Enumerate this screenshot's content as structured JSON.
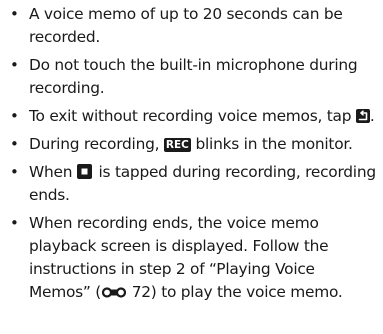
{
  "notes": [
    {
      "text": "A voice memo of up to 20 seconds can be recorded."
    },
    {
      "text": "Do not touch the built-in microphone during recording."
    },
    {
      "before": "To exit without recording voice memos, tap",
      "icon": "back-icon",
      "after": "."
    },
    {
      "before": "During recording,",
      "icon": "rec-icon",
      "icon_label": "REC",
      "after": "blinks in the monitor."
    },
    {
      "before": "When",
      "icon": "stop-icon",
      "after": "is tapped during recording, recording ends."
    },
    {
      "before": "When recording ends, the voice memo playback screen is displayed. Follow the instructions in step 2 of “Playing Voice Memos” (",
      "icon": "cross-reference-icon",
      "ref_page": "72",
      "after": ") to play the voice memo."
    }
  ],
  "bullet_char": "•"
}
